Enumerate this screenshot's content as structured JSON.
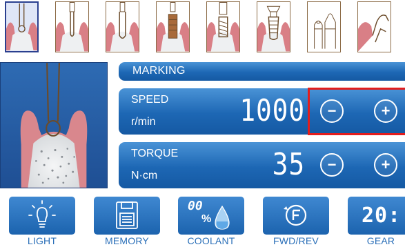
{
  "steps": [
    {
      "name": "step-1",
      "active": true
    },
    {
      "name": "step-2",
      "active": false
    },
    {
      "name": "step-3",
      "active": false
    },
    {
      "name": "step-4",
      "active": false
    },
    {
      "name": "step-5",
      "active": false
    },
    {
      "name": "step-6",
      "active": false
    },
    {
      "name": "step-7",
      "active": false
    },
    {
      "name": "step-8",
      "active": false
    }
  ],
  "marking": {
    "title": "MARKING"
  },
  "speed": {
    "label": "SPEED",
    "unit": "r/min",
    "value": "1000",
    "minus": "−",
    "plus": "+"
  },
  "torque": {
    "label": "TORQUE",
    "unit": "N·cm",
    "value": "35",
    "minus": "−",
    "plus": "+"
  },
  "coolant": {
    "digits": "00",
    "percent": "%"
  },
  "gear": {
    "display": "20:"
  },
  "tools": {
    "light": "LIGHT",
    "memory": "MEMORY",
    "coolant": "COOLANT",
    "fwdrev": "FWD/REV",
    "gear": "GEAR"
  },
  "colors": {
    "panel": "#1d67b4",
    "highlight": "#e31d1d",
    "label_text": "#2a6fb8",
    "gum": "#d97f86",
    "bone": "#eef0f2"
  }
}
